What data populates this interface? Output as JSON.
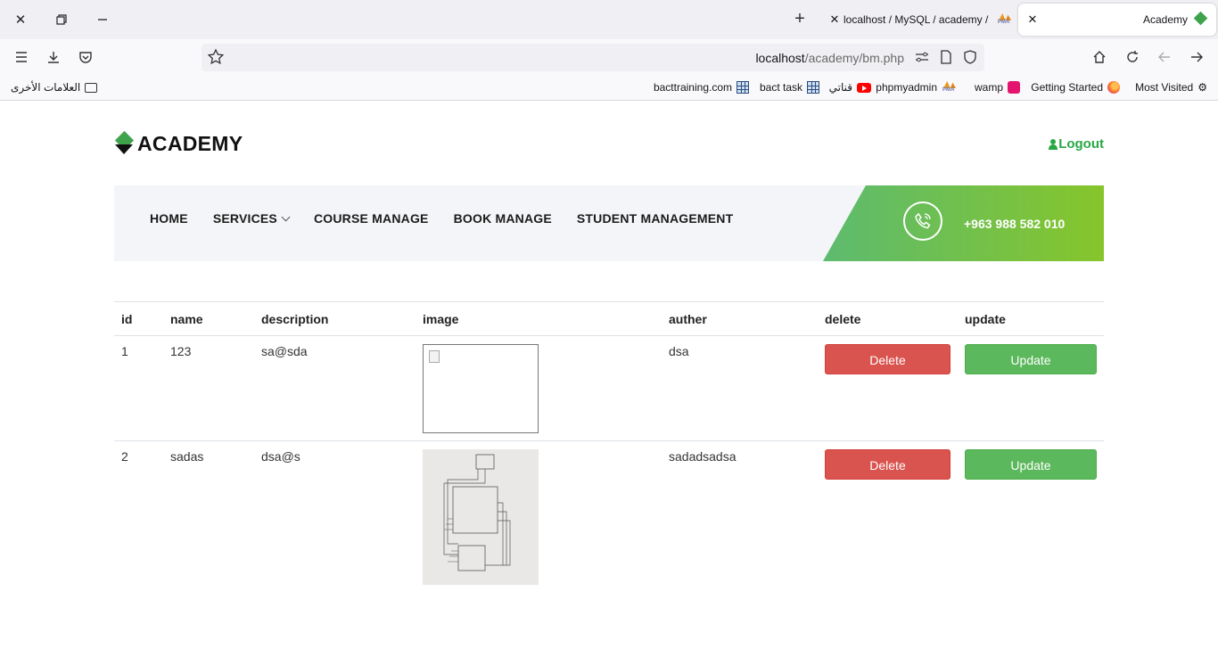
{
  "browser": {
    "tabs": [
      {
        "label": "localhost / MySQL / academy / ",
        "active": false
      },
      {
        "label": "Academy",
        "active": true
      }
    ],
    "url_host": "localhost",
    "url_path": "/academy/bm.php",
    "bookmarks": [
      {
        "label": "Most Visited",
        "icon": "gear-icon"
      },
      {
        "label": "Getting Started",
        "icon": "firefox-icon"
      },
      {
        "label": "wamp",
        "icon": "wamp-icon"
      },
      {
        "label": "phpmyadmin",
        "icon": "pma-icon"
      },
      {
        "label": "قناتي",
        "icon": "youtube-icon"
      },
      {
        "label": "bact task",
        "icon": "grid-icon"
      },
      {
        "label": "bacttraining.com",
        "icon": "grid-icon"
      }
    ],
    "other_bookmarks": "العلامات الأخرى"
  },
  "site": {
    "logo_text": "ACADEMY",
    "logout_label": "Logout",
    "menu": [
      "HOME",
      "SERVICES",
      "COURSE MANAGE",
      "BOOK MANAGE",
      "STUDENT MANAGEMENT"
    ],
    "phone": "+963 988 582 010"
  },
  "table": {
    "columns": [
      "id",
      "name",
      "description",
      "image",
      "auther",
      "delete",
      "update"
    ],
    "rows": [
      {
        "id": "1",
        "name": "123",
        "description": "sa@sda",
        "image": "broken",
        "auther": "dsa",
        "delete": "Delete",
        "update": "Update"
      },
      {
        "id": "2",
        "name": "sadas",
        "description": "dsa@s",
        "image": "sketch",
        "auther": "sadadsadsa",
        "delete": "Delete",
        "update": "Update"
      }
    ]
  },
  "colors": {
    "accent_green": "#28a745",
    "delete_red": "#d9534f",
    "update_green": "#5cb85c"
  }
}
